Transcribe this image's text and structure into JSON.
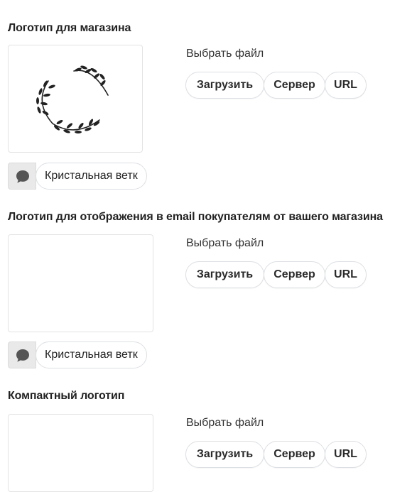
{
  "sections": [
    {
      "title": "Логотип для магазина",
      "choose_file_label": "Выбрать файл",
      "buttons": {
        "upload": "Загрузить",
        "server": "Сервер",
        "url": "URL"
      },
      "alt_text_value": "Кристальная ветка"
    },
    {
      "title": "Логотип для отображения в email покупателям от вашего магазина",
      "choose_file_label": "Выбрать файл",
      "buttons": {
        "upload": "Загрузить",
        "server": "Сервер",
        "url": "URL"
      },
      "alt_text_value": "Кристальная ветка"
    },
    {
      "title": "Компактный логотип",
      "choose_file_label": "Выбрать файл",
      "buttons": {
        "upload": "Загрузить",
        "server": "Сервер",
        "url": "URL"
      }
    }
  ],
  "icons": {
    "chat": "speech-bubble-icon",
    "logo": "laurel-wreath-logo"
  },
  "colors": {
    "border": "#dcdfe3",
    "chat_button_bg": "#e9e9e9",
    "icon": "#555555"
  }
}
